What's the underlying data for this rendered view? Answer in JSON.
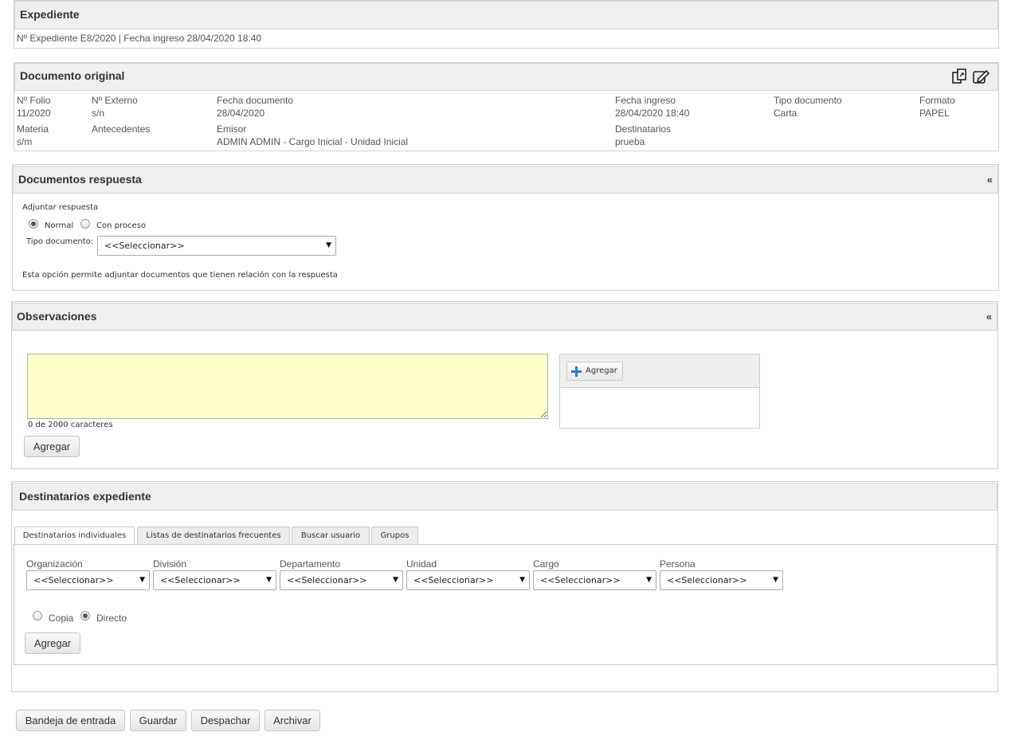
{
  "expediente": {
    "title": "Expediente",
    "summary": "Nº Expediente E8/2020 | Fecha ingreso 28/04/2020 18:40"
  },
  "documento": {
    "title": "Documento original",
    "icons": [
      "copy-documents-icon",
      "edit-icon"
    ],
    "row1": [
      {
        "label": "Nº Folio",
        "value": "11/2020"
      },
      {
        "label": "Nº Externo",
        "value": "s/n"
      },
      {
        "label": "Fecha documento",
        "value": "28/04/2020"
      },
      {
        "label": "Fecha ingreso",
        "value": "28/04/2020 18:40"
      },
      {
        "label": "Tipo documento",
        "value": "Carta"
      },
      {
        "label": "Formato",
        "value": "PAPEL"
      }
    ],
    "row2": [
      {
        "label": "Materia",
        "value": "s/m"
      },
      {
        "label": "Antecedentes",
        "value": ""
      },
      {
        "label": "Emisor",
        "value": "ADMIN ADMIN - Cargo Inicial - Unidad Inicial"
      },
      {
        "label": "Destinatarios",
        "value": "prueba"
      }
    ]
  },
  "respuesta": {
    "title": "Documentos respuesta",
    "collapse": "«",
    "adjuntar_label": "Adjuntar respuesta",
    "radio_normal": "Normal",
    "radio_con_proceso": "Con proceso",
    "tipo_label": "Tipo documento:",
    "tipo_value": "<<Seleccionar>>",
    "help": "Esta opción permite adjuntar documentos que tienen relación con la respuesta"
  },
  "observaciones": {
    "title": "Observaciones",
    "collapse": "«",
    "textarea_value": "",
    "counter": "0 de 2000 caracteres",
    "add_button": "Agregar",
    "attach_add": "Agregar"
  },
  "destinatarios": {
    "title": "Destinatarios expediente",
    "tabs": [
      "Destinatarios individuales",
      "Listas de destinatarios frecuentes",
      "Buscar usuario",
      "Grupos"
    ],
    "filters": [
      {
        "label": "Organización",
        "value": "<<Seleccionar>>"
      },
      {
        "label": "División",
        "value": "<<Seleccionar>>"
      },
      {
        "label": "Departamento",
        "value": "<<Seleccionar>>"
      },
      {
        "label": "Unidad",
        "value": "<<Seleccionar>>"
      },
      {
        "label": "Cargo",
        "value": "<<Seleccionar>>"
      },
      {
        "label": "Persona",
        "value": "<<Seleccionar>>"
      }
    ],
    "radio_copia": "Copia",
    "radio_directo": "Directo",
    "add_button": "Agregar"
  },
  "footer": {
    "buttons": [
      "Bandeja de entrada",
      "Guardar",
      "Despachar",
      "Archivar"
    ]
  }
}
